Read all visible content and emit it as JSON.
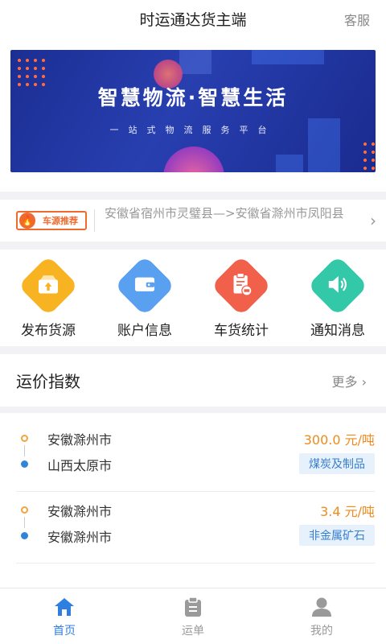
{
  "header": {
    "title": "时运通达货主端",
    "service_label": "客服"
  },
  "banner": {
    "headline": "智慧物流·智慧生活",
    "tagline": "一站式物流服务平台"
  },
  "notice": {
    "badge_label": "车源推荐",
    "message": "安徽省宿州市灵璧县—>安徽省滁州市凤阳县"
  },
  "menu": {
    "items": [
      {
        "label": "发布货源",
        "icon": "upload-box-icon",
        "color": "#f7b321"
      },
      {
        "label": "账户信息",
        "icon": "wallet-icon",
        "color": "#5aa0f0"
      },
      {
        "label": "车货统计",
        "icon": "clipboard-truck-icon",
        "color": "#f0604a"
      },
      {
        "label": "通知消息",
        "icon": "speaker-icon",
        "color": "#33c9a8"
      }
    ]
  },
  "freight_index": {
    "title": "运价指数",
    "more_label": "更多",
    "routes": [
      {
        "from": "安徽滁州市",
        "to": "山西太原市",
        "price": "300.0 元/吨",
        "category": "煤炭及制品"
      },
      {
        "from": "安徽滁州市",
        "to": "安徽滁州市",
        "price": "3.4 元/吨",
        "category": "非金属矿石"
      }
    ]
  },
  "tabbar": {
    "tabs": [
      {
        "label": "首页",
        "icon": "home-icon",
        "active": true
      },
      {
        "label": "运单",
        "icon": "waybill-icon",
        "active": false
      },
      {
        "label": "我的",
        "icon": "user-icon",
        "active": false
      }
    ],
    "active_color": "#2f7fe0",
    "inactive_color": "#9a9a9a"
  }
}
